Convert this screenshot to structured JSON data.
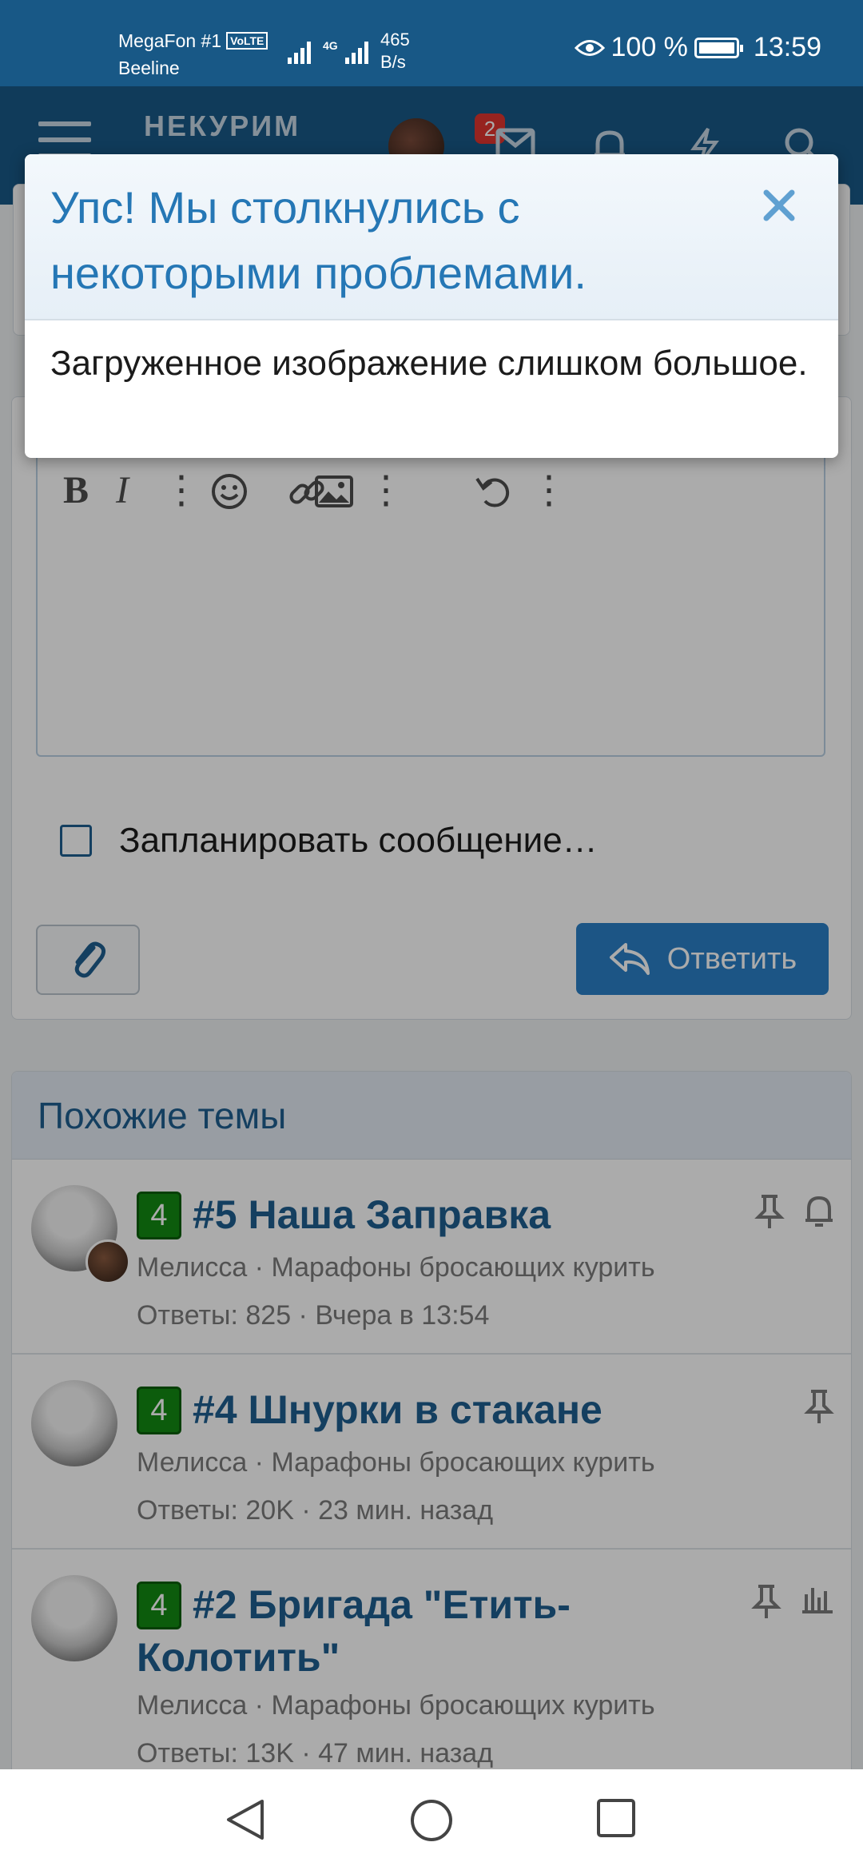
{
  "status_bar": {
    "carrier_primary": "MegaFon #1",
    "volte": "VoLTE",
    "carrier_secondary": "Beeline",
    "network_type": "4G",
    "net_speed_value": "465",
    "net_speed_unit": "B/s",
    "battery": "100 %",
    "time": "13:59"
  },
  "header": {
    "logo_text": "НЕКУРИМ",
    "notifications_count": "2"
  },
  "editor": {
    "schedule_label": "Запланировать сообщение…",
    "reply_label": "Ответить"
  },
  "similar": {
    "heading": "Похожие темы",
    "topics": [
      {
        "badge": "4",
        "title": "#5 Наша Заправка",
        "meta_line1": "Мелисса · Марафоны бросающих курить",
        "meta_line2": "Ответы: 825 · Вчера в 13:54"
      },
      {
        "badge": "4",
        "title": "#4 Шнурки в стакане",
        "meta_line1": "Мелисса · Марафоны бросающих курить",
        "meta_line2": "Ответы: 20K · 23 мин. назад"
      },
      {
        "badge": "4",
        "title": "#2 Бригада \"Етить-Колотить\"",
        "meta_line1": "Мелисса · Марафоны бросающих курить",
        "meta_line2": "Ответы: 13K · 47 мин. назад"
      }
    ]
  },
  "modal": {
    "title": "Упс! Мы столкнулись с некоторыми проблемами.",
    "message": "Загруженное изображение слишком большое."
  },
  "colors": {
    "brand_blue": "#185886",
    "link_blue": "#1f5f8f",
    "button_blue": "#2a7fc6",
    "badge_green": "#138a13",
    "notification_red": "#e0352f"
  }
}
